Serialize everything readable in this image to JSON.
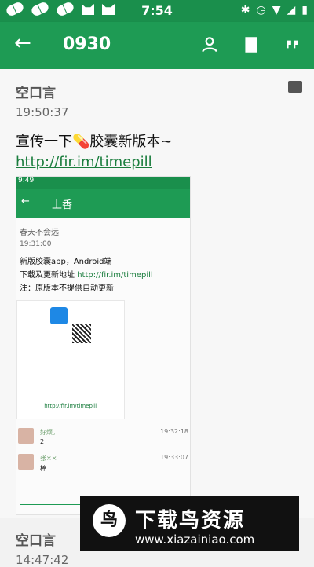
{
  "status": {
    "time": "7:54"
  },
  "appbar": {
    "title": "0930",
    "back_icon": "arrow-left-icon",
    "icons": [
      "person-icon",
      "bookmark-icon",
      "quote-icon"
    ]
  },
  "post": {
    "author": "空口言",
    "time": "19:50:37",
    "text": "宣传一下💊胶囊新版本~",
    "link": "http://fir.im/timepill"
  },
  "shot": {
    "status": "9:49",
    "title": "上香",
    "author": "春天不会远",
    "time": "19:31:00",
    "line1": "新版胶囊app，Android端",
    "line2_prefix": "下载及更新地址 ",
    "line2_link": "http://fir.im/timepill",
    "line3": "注：原版本不提供自动更新",
    "thumb_url": "http://fir.im/timepill",
    "comments": [
      {
        "name": "好烦。",
        "time": "19:32:18",
        "text": "2"
      },
      {
        "name": "张××",
        "time": "19:33:07",
        "text": "棒"
      }
    ]
  },
  "next": {
    "author": "空口言",
    "time": "14:47:42"
  },
  "watermark": {
    "title": "下载鸟资源",
    "url": "www.xiazainiao.com"
  }
}
